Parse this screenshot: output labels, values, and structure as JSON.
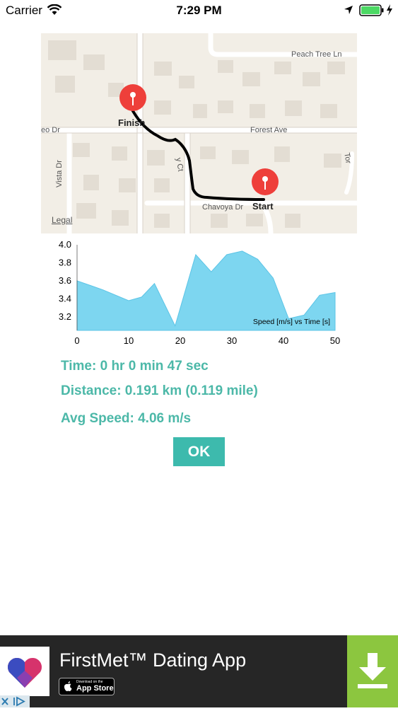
{
  "status_bar": {
    "carrier": "Carrier",
    "time": "7:29 PM"
  },
  "map": {
    "streets": [
      "Peach Tree Ln",
      "Forest Ave",
      "Chavoya Dr",
      "Vista Dr",
      "eo Dr",
      "y Ct",
      "Tor"
    ],
    "start_label": "Start",
    "finish_label": "Finish",
    "legal": "Legal"
  },
  "chart_data": {
    "type": "area",
    "annotation": "Speed [m/s] vs Time [s]",
    "x": [
      0,
      5,
      10,
      12.5,
      15,
      19,
      23,
      26,
      29,
      32,
      35,
      38,
      41,
      44,
      47,
      50
    ],
    "y": [
      3.6,
      3.5,
      3.38,
      3.42,
      3.57,
      3.1,
      3.89,
      3.7,
      3.89,
      3.93,
      3.84,
      3.63,
      3.18,
      3.22,
      3.44,
      3.47
    ],
    "xlim": [
      0,
      50
    ],
    "ylim": [
      3.05,
      4.0
    ],
    "xticks": [
      "0",
      "10",
      "20",
      "30",
      "40",
      "50"
    ],
    "yticks": [
      "4.0",
      "3.8",
      "3.6",
      "3.4",
      "3.2"
    ],
    "color": "#7dd6f0"
  },
  "stats": {
    "time": "Time: 0 hr 0 min 47 sec",
    "distance": "Distance: 0.191 km (0.119 mile)",
    "avg_speed": "Avg Speed: 4.06 m/s"
  },
  "ok_label": "OK",
  "ad": {
    "title": "FirstMet™ Dating App",
    "store_small": "Download on the",
    "store_big": "App Store",
    "accent": "#8cc63f"
  }
}
